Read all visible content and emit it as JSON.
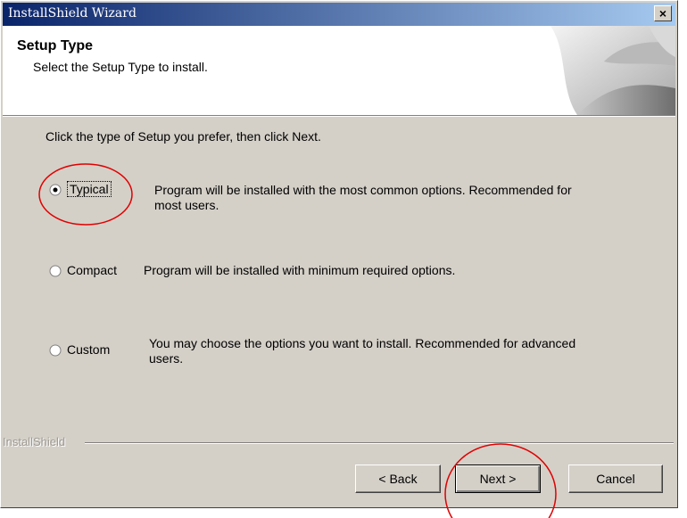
{
  "window": {
    "title": "InstallShield Wizard",
    "close_label": "×"
  },
  "header": {
    "title": "Setup Type",
    "subtitle": "Select the Setup Type to install."
  },
  "instruction": "Click the type of Setup you prefer, then click Next.",
  "options": [
    {
      "label": "Typical",
      "desc_line1": "Program will be installed with the most common options.  Recommended for",
      "desc_line2": "most users.",
      "selected": true
    },
    {
      "label": "Compact",
      "desc_line1": "Program will be installed with minimum required options.",
      "desc_line2": "",
      "selected": false
    },
    {
      "label": "Custom",
      "desc_line1": "You may choose the options you want to install. Recommended for advanced",
      "desc_line2": "users.",
      "selected": false
    }
  ],
  "footer": {
    "brand": "InstallShield"
  },
  "buttons": {
    "back": "< Back",
    "next": "Next >",
    "cancel": "Cancel"
  },
  "colors": {
    "annotation": "#e00000",
    "titlebar": "#0a246a",
    "face": "#d4d0c8"
  }
}
